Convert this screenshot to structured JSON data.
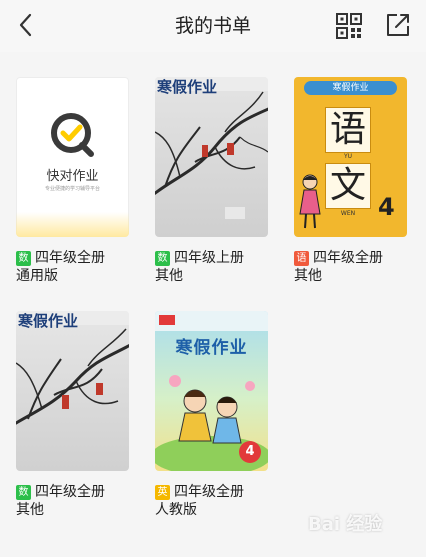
{
  "header": {
    "title": "我的书单"
  },
  "colors": {
    "math": "#2cbf4a",
    "chinese": "#f05a3c",
    "english": "#f5b800",
    "brand": "#ffcc00"
  },
  "books": [
    {
      "badge": "数",
      "subject": "math",
      "line1": "四年级全册",
      "line2": "通用版",
      "cover": {
        "type": "brand",
        "brand_name": "快对作业",
        "tagline": "专业便捷的学习辅导平台"
      }
    },
    {
      "badge": "数",
      "subject": "math",
      "line1": "四年级上册",
      "line2": "其他",
      "cover": {
        "type": "photo",
        "title_text": "寒假作业"
      }
    },
    {
      "badge": "语",
      "subject": "chinese",
      "line1": "四年级全册",
      "line2": "其他",
      "cover": {
        "type": "yuwen",
        "top_text": "寒假作业",
        "char1": "语",
        "pinyin1": "YU",
        "char2": "文",
        "pinyin2": "WEN",
        "grade": "4"
      }
    },
    {
      "badge": "数",
      "subject": "math",
      "line1": "四年级全册",
      "line2": "其他",
      "cover": {
        "type": "photo",
        "title_text": "寒假作业"
      }
    },
    {
      "badge": "英",
      "subject": "english",
      "line1": "四年级全册",
      "line2": "人教版",
      "cover": {
        "type": "cartoon",
        "title_text": "寒假作业",
        "grade": "4"
      }
    }
  ],
  "watermark": "Bai 经验"
}
